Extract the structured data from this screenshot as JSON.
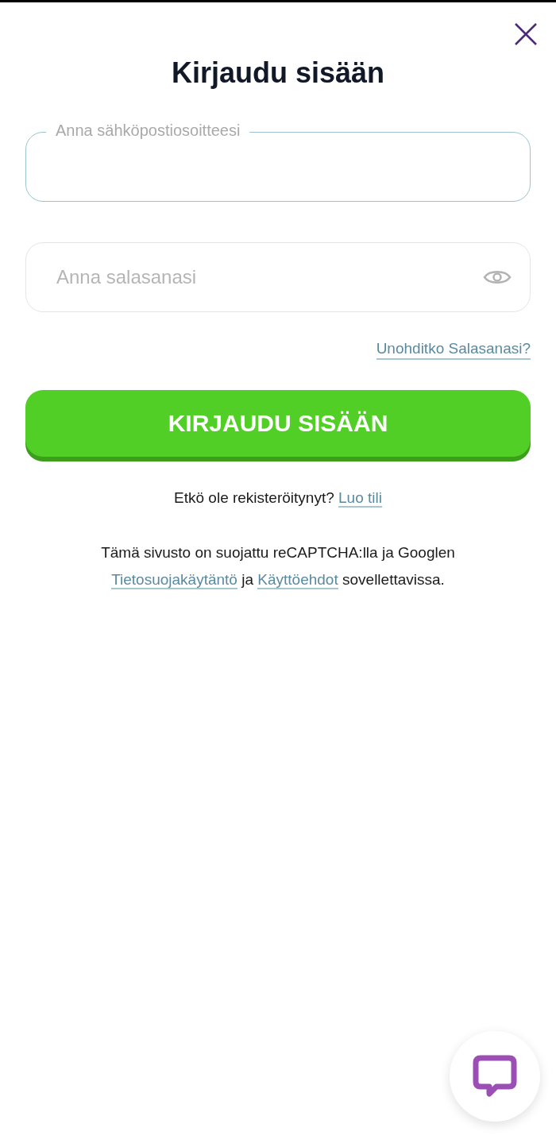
{
  "title": "Kirjaudu sisään",
  "email_field": {
    "label": "Anna sähköpostiosoitteesi"
  },
  "password_field": {
    "placeholder": "Anna salasanasi"
  },
  "forgot_link": "Unohditko Salasanasi?",
  "login_button": "KIRJAUDU SISÄÄN",
  "register": {
    "text": "Etkö ole rekisteröitynyt?",
    "link": "Luo tili"
  },
  "recaptcha_notice": [
    {
      "kind": "text",
      "text": "Tämä sivusto on suojattu reCAPTCHA:lla ja Googlen"
    },
    {
      "kind": "break"
    },
    {
      "kind": "link",
      "text": "Tietosuojakäytäntö"
    },
    {
      "kind": "text",
      "text": " ja "
    },
    {
      "kind": "link",
      "text": "Käyttöehdot"
    },
    {
      "kind": "text",
      "text": " sovellettavissa."
    }
  ]
}
